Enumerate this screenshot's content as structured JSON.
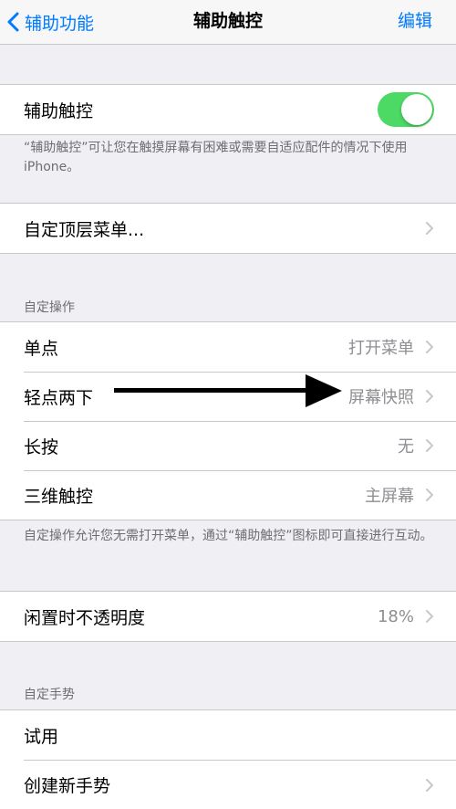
{
  "nav": {
    "back_label": "辅助功能",
    "title": "辅助触控",
    "edit_label": "编辑"
  },
  "assistive_touch": {
    "label": "辅助触控",
    "enabled": true,
    "note": "“辅助触控”可让您在触摸屏幕有困难或需要自适应配件的情况下使用 iPhone。"
  },
  "top_menu": {
    "label": "自定顶层菜单..."
  },
  "custom_actions": {
    "header": "自定操作",
    "items": [
      {
        "label": "单点",
        "value": "打开菜单"
      },
      {
        "label": "轻点两下",
        "value": "屏幕快照"
      },
      {
        "label": "长按",
        "value": "无"
      },
      {
        "label": "三维触控",
        "value": "主屏幕"
      }
    ],
    "note": "自定操作允许您无需打开菜单，通过“辅助触控”图标即可直接进行互动。"
  },
  "idle_opacity": {
    "label": "闲置时不透明度",
    "value": "18%"
  },
  "custom_gestures": {
    "header": "自定手势",
    "items": [
      {
        "label": "试用"
      },
      {
        "label": "创建新手势"
      }
    ]
  },
  "colors": {
    "accent": "#007aff",
    "toggle_on": "#4cd964",
    "background": "#efeff4"
  }
}
